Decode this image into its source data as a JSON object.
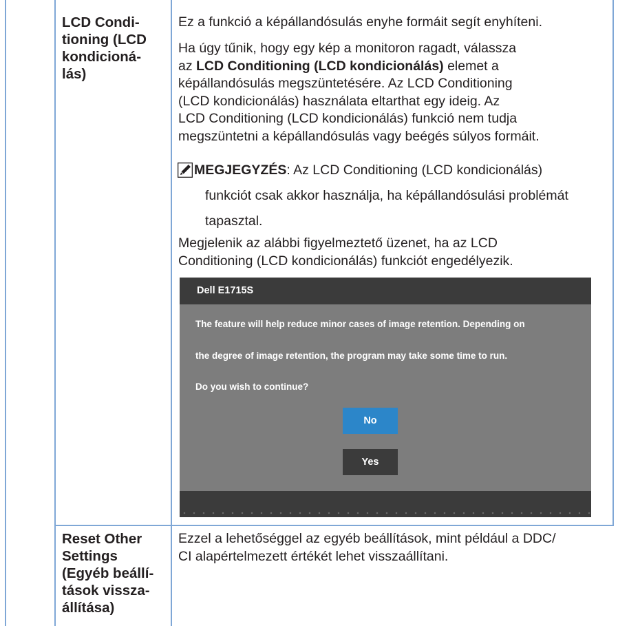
{
  "rows": [
    {
      "label_lines": [
        "LCD Condi-",
        "tioning (LCD",
        "kondicioná-",
        "lás)"
      ]
    },
    {
      "label_lines": [
        "Reset Other",
        "Settings",
        "(Egyéb beállí-",
        "tások vissza-",
        "állítása)"
      ]
    }
  ],
  "lcd": {
    "intro": "Ez a funkció a képállandósulás enyhe formáit segít enyhíteni.",
    "para2_line1": "Ha úgy tűnik, hogy egy kép a monitoron ragadt, válassza",
    "para2_line2_pre": "az ",
    "para2_line2_bold": "LCD Conditioning (LCD kondicionálás)",
    "para2_line2_post": " elemet a",
    "para2_line3": "képállandósulás megszüntetésére. Az LCD Conditioning",
    "para2_line4": "(LCD kondicionálás) használata eltarthat egy ideig. Az",
    "para2_line5": "LCD Conditioning (LCD kondicionálás) funkció nem tudja",
    "para2_line6": "megszüntetni a képállandósulás vagy beégés súlyos formáit.",
    "note_label": "MEGJEGYZÉS",
    "note_line1_rest": ": Az LCD Conditioning (LCD kondicionálás)",
    "note_line2": "funkciót csak akkor használja, ha képállandósulási problémát",
    "note_line3": "tapasztal.",
    "warn_line1": "Megjelenik az alábbi figyelmeztető üzenet, ha az LCD",
    "warn_line2": "Conditioning (LCD kondicionálás) funkciót engedélyezik."
  },
  "osd": {
    "title": "Dell E1715S",
    "message_lines": [
      "The feature will help reduce minor cases of image retention. Depending on",
      "the degree of image retention, the program may take some time to run.",
      "Do you wish to continue?"
    ],
    "btn_no": "No",
    "btn_yes": "Yes",
    "icon": "pencil-note-icon",
    "colors": {
      "titlebar": "#3b3b3b",
      "body": "#7d7d7d",
      "no_button": "#2c86c9",
      "yes_button": "#3b3b3b"
    }
  },
  "reset": {
    "line1": "Ezzel a lehetőséggel az egyéb beállítások, mint például a DDC/",
    "line2": "CI alapértelmezett értékét lehet visszaállítani."
  },
  "table_border_color": "#7fa7d6"
}
